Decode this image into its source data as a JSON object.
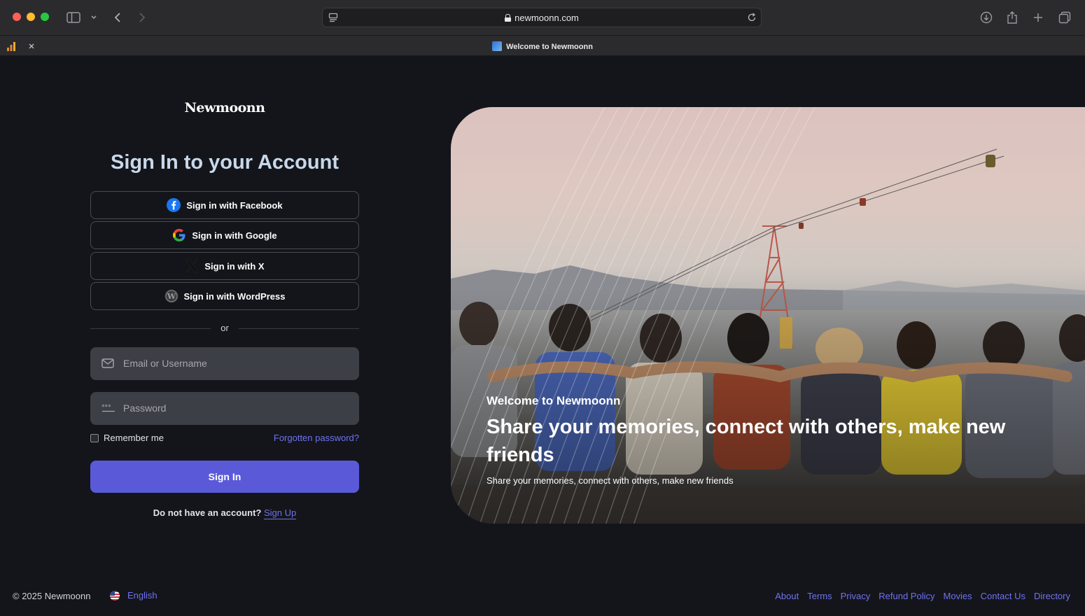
{
  "browser": {
    "url": "newmoonn.com",
    "tab_title": "Welcome to Newmoonn"
  },
  "brand": {
    "name": "Newmoonn"
  },
  "signin": {
    "heading": "Sign In to your Account",
    "facebook_label": "Sign in with Facebook",
    "google_label": "Sign in with Google",
    "x_label": "Sign in with X",
    "wordpress_label": "Sign in with WordPress",
    "divider": "or",
    "email_placeholder": "Email or Username",
    "password_placeholder": "Password",
    "remember_label": "Remember me",
    "forgot_label": "Forgotten password?",
    "submit_label": "Sign In",
    "no_account_text": "Do not have an account?",
    "signup_label": "Sign Up"
  },
  "hero": {
    "subtitle": "Welcome to Newmoonn",
    "title": "Share your memories, connect with others, make new friends",
    "description": "Share your memories, connect with others, make new friends"
  },
  "footer": {
    "copyright": "© 2025 Newmoonn",
    "language": "English",
    "links": [
      "About",
      "Terms",
      "Privacy",
      "Refund Policy",
      "Movies",
      "Contact Us",
      "Directory"
    ]
  },
  "colors": {
    "accent": "#5a5ad9",
    "link": "#6f72f0",
    "background": "#14151a",
    "heading": "#c8d8ea"
  }
}
